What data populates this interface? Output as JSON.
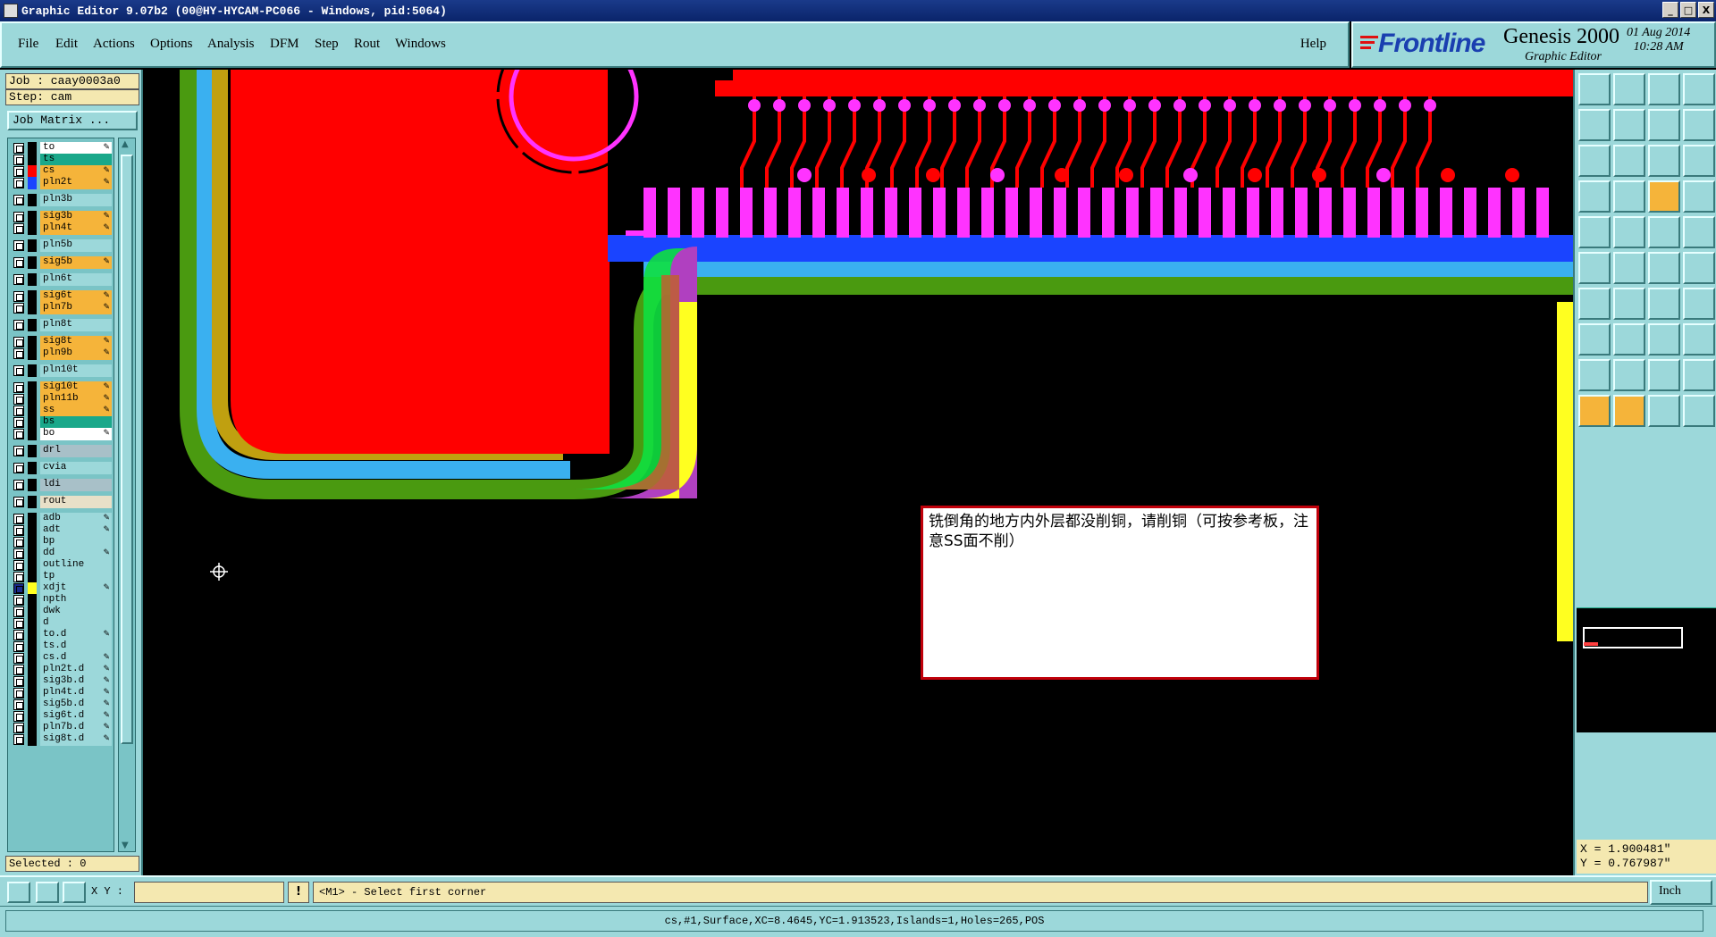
{
  "window": {
    "title": "Graphic Editor 9.07b2 (00@HY-HYCAM-PC066 - Windows, pid:5064)",
    "min": "_",
    "max": "□",
    "close": "X"
  },
  "menu": [
    "File",
    "Edit",
    "Actions",
    "Options",
    "Analysis",
    "DFM",
    "Step",
    "Rout",
    "Windows"
  ],
  "help": "Help",
  "brand": {
    "company": "Frontline",
    "product": "Genesis 2000",
    "subtitle": "Graphic Editor",
    "date": "01 Aug 2014",
    "time": "10:28 AM"
  },
  "left": {
    "job": "Job : caay0003a0",
    "step": "Step: cam",
    "job_matrix": "Job Matrix ...",
    "selected": "Selected : 0"
  },
  "layers": [
    {
      "name": "to",
      "color": "#ffffff",
      "lock": true
    },
    {
      "name": "ts",
      "color": "#1aa88a",
      "lock": false
    },
    {
      "name": "cs",
      "color": "#f5b43a",
      "lock": true,
      "active": true
    },
    {
      "name": "pln2t",
      "color": "#f5b43a",
      "lock": true,
      "blue": true
    },
    {
      "name": "pln3b",
      "color": "#9cd8da",
      "lock": false
    },
    {
      "name": "sig3b",
      "color": "#f5b43a",
      "lock": true
    },
    {
      "name": "pln4t",
      "color": "#f5b43a",
      "lock": true
    },
    {
      "name": "pln5b",
      "color": "#9cd8da",
      "lock": false
    },
    {
      "name": "sig5b",
      "color": "#f5b43a",
      "lock": true
    },
    {
      "name": "pln6t",
      "color": "#9cd8da",
      "lock": false
    },
    {
      "name": "sig6t",
      "color": "#f5b43a",
      "lock": true
    },
    {
      "name": "pln7b",
      "color": "#f5b43a",
      "lock": true
    },
    {
      "name": "pln8t",
      "color": "#9cd8da",
      "lock": false
    },
    {
      "name": "sig8t",
      "color": "#f5b43a",
      "lock": true
    },
    {
      "name": "pln9b",
      "color": "#f5b43a",
      "lock": true
    },
    {
      "name": "pln10t",
      "color": "#9cd8da",
      "lock": false
    },
    {
      "name": "sig10t",
      "color": "#f5b43a",
      "lock": true
    },
    {
      "name": "pln11b",
      "color": "#f5b43a",
      "lock": true
    },
    {
      "name": "ss",
      "color": "#f5b43a",
      "lock": true
    },
    {
      "name": "bs",
      "color": "#1aa88a",
      "lock": false
    },
    {
      "name": "bo",
      "color": "#ffffff",
      "lock": true
    },
    {
      "name": "drl",
      "color": "#a8c0c8",
      "lock": false
    },
    {
      "name": "cvia",
      "color": "#9cd8da",
      "lock": false
    },
    {
      "name": "ldi",
      "color": "#a8c0c8",
      "lock": false
    },
    {
      "name": "rout",
      "color": "#e8e0c8",
      "lock": false
    },
    {
      "name": "adb",
      "color": "#9cd8da",
      "lock": true
    },
    {
      "name": "adt",
      "color": "#9cd8da",
      "lock": true
    },
    {
      "name": "bp",
      "color": "#9cd8da",
      "lock": false
    },
    {
      "name": "dd",
      "color": "#9cd8da",
      "lock": true
    },
    {
      "name": "outline",
      "color": "#9cd8da",
      "lock": false
    },
    {
      "name": "tp",
      "color": "#9cd8da",
      "lock": false
    },
    {
      "name": "xdjt",
      "color": "#9cd8da",
      "lock": true,
      "yellow": true
    },
    {
      "name": "npth",
      "color": "#9cd8da",
      "lock": false
    },
    {
      "name": "dwk",
      "color": "#9cd8da",
      "lock": false
    },
    {
      "name": "d",
      "color": "#9cd8da",
      "lock": false
    },
    {
      "name": "to.d",
      "color": "#9cd8da",
      "lock": true
    },
    {
      "name": "ts.d",
      "color": "#9cd8da",
      "lock": false
    },
    {
      "name": "cs.d",
      "color": "#9cd8da",
      "lock": true
    },
    {
      "name": "pln2t.d",
      "color": "#9cd8da",
      "lock": true
    },
    {
      "name": "sig3b.d",
      "color": "#9cd8da",
      "lock": true
    },
    {
      "name": "pln4t.d",
      "color": "#9cd8da",
      "lock": true
    },
    {
      "name": "sig5b.d",
      "color": "#9cd8da",
      "lock": true
    },
    {
      "name": "sig6t.d",
      "color": "#9cd8da",
      "lock": true
    },
    {
      "name": "pln7b.d",
      "color": "#9cd8da",
      "lock": true
    },
    {
      "name": "sig8t.d",
      "color": "#9cd8da",
      "lock": true
    }
  ],
  "note": "铣倒角的地方内外层都没削铜，请削铜（可按参考板，注意SS面不削）",
  "coords": {
    "x": "X = 1.900481\"",
    "y": "Y = 0.767987\""
  },
  "bottom": {
    "xy_label": "X Y :",
    "xy_value": "",
    "exclaim": "!",
    "prompt": "<M1> - Select first corner",
    "unit": "Inch"
  },
  "status": "cs,#1,Surface,XC=8.4645,YC=1.913523,Islands=1,Holes=265,POS",
  "colors": {
    "accent": "#9cd8da",
    "copper": "#ff0000",
    "pad": "#ff33ff",
    "field": "#f4e8b0"
  }
}
